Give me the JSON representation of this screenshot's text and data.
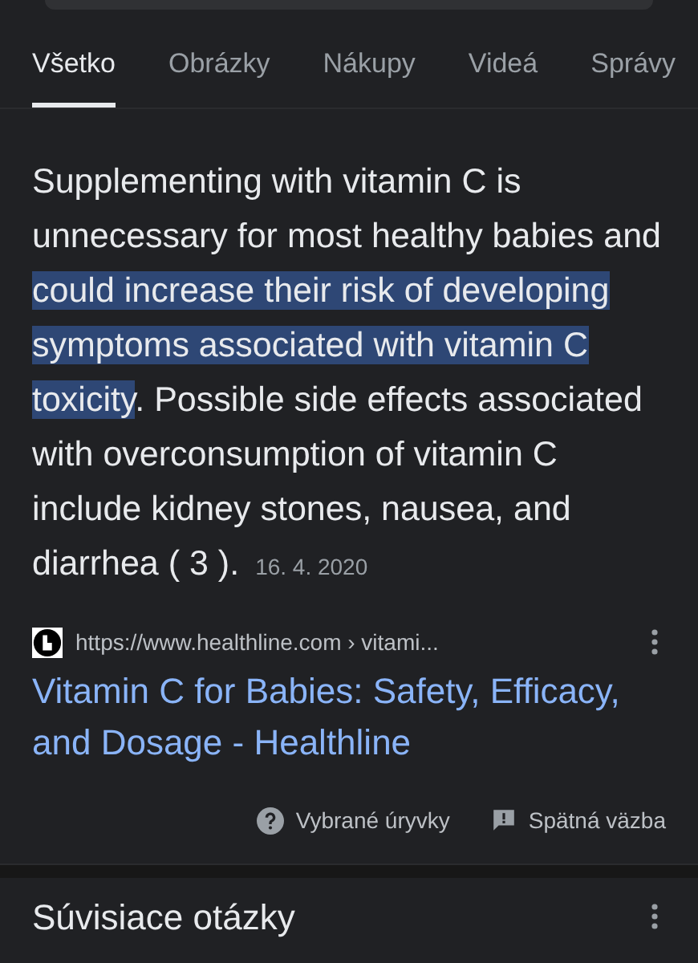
{
  "tabs": [
    {
      "label": "Všetko",
      "selected": true
    },
    {
      "label": "Obrázky",
      "selected": false
    },
    {
      "label": "Nákupy",
      "selected": false
    },
    {
      "label": "Videá",
      "selected": false
    },
    {
      "label": "Správy",
      "selected": false
    }
  ],
  "snippet": {
    "parts": [
      {
        "text": "Supplementing with vitamin C is unnecessary for most healthy babies and ",
        "highlighted": false
      },
      {
        "text": "could increase their risk of developing symptoms associated with vitamin C toxicity",
        "highlighted": true
      },
      {
        "text": ". Possible side effects associated with overconsumption of vitamin C include kidney stones, nausea, and diarrhea ( 3 ).",
        "highlighted": false
      }
    ],
    "date": "16. 4. 2020"
  },
  "result": {
    "url": "https://www.healthline.com › vitami...",
    "title": "Vitamin C for Babies: Safety, Efficacy, and Dosage - Healthline"
  },
  "footer": [
    "Vybrané úryvky",
    "Spätná väzba"
  ],
  "related": {
    "heading": "Súvisiace otázky"
  }
}
